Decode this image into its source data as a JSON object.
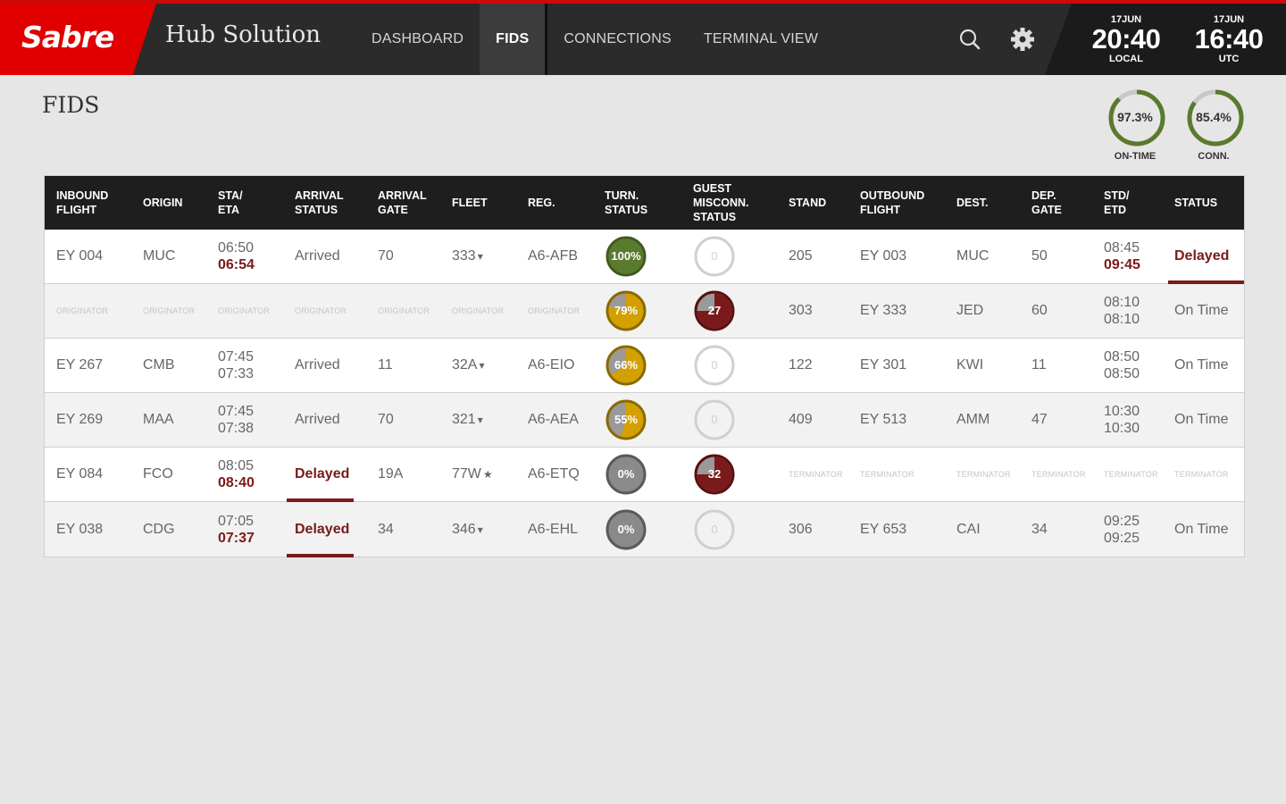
{
  "header": {
    "logo": "Sabre",
    "app_title": "Hub Solution",
    "nav": [
      {
        "label": "DASHBOARD",
        "active": false
      },
      {
        "label": "FIDS",
        "active": true
      },
      {
        "label": "CONNECTIONS",
        "active": false
      },
      {
        "label": "TERMINAL VIEW",
        "active": false
      }
    ],
    "icons": [
      "search-icon",
      "gear-icon"
    ],
    "clocks": [
      {
        "date": "17JUN",
        "time": "20:40",
        "zone": "LOCAL"
      },
      {
        "date": "17JUN",
        "time": "16:40",
        "zone": "UTC"
      }
    ]
  },
  "page_title": "FIDS",
  "kpis": [
    {
      "value": "97.3%",
      "label": "ON-TIME",
      "fraction": 0.88,
      "color": "#5a7a2e"
    },
    {
      "value": "85.4%",
      "label": "CONN.",
      "fraction": 0.85,
      "color": "#5a7a2e"
    }
  ],
  "colors": {
    "brand_red": "#e00000",
    "delay_red": "#7a1a1a",
    "turn_green": "#5a7a2e",
    "turn_amber": "#d4a000",
    "turn_grey": "#8a8a8a"
  },
  "table": {
    "columns": [
      "INBOUND\nFLIGHT",
      "ORIGIN",
      "STA/\nETA",
      "ARRIVAL\nSTATUS",
      "ARRIVAL\nGATE",
      "FLEET",
      "REG.",
      "TURN.\nSTATUS",
      "GUEST\nMISCONN.\nSTATUS",
      "STAND",
      "OUTBOUND\nFLIGHT",
      "DEST.",
      "DEP.\nGATE",
      "STD/\nETD",
      "STATUS"
    ],
    "rows": [
      {
        "inbound": "EY 004",
        "origin": "MUC",
        "sta": "06:50",
        "eta": "06:54",
        "eta_late": true,
        "arr_status": "Arrived",
        "arr_gate": "70",
        "fleet": "333",
        "fleet_mark": "▾",
        "reg": "A6-AFB",
        "turn": "100%",
        "turn_frac": 1.0,
        "turn_color": "#5a7a2e",
        "guest": "0",
        "guest_frac": 0,
        "stand": "205",
        "outbound": "EY 003",
        "dest": "MUC",
        "dep_gate": "50",
        "std": "08:45",
        "etd": "09:45",
        "etd_late": true,
        "status": "Delayed"
      },
      {
        "originator": "ORIGINATOR",
        "turn": "79%",
        "turn_frac": 0.79,
        "turn_color": "#d4a000",
        "guest": "27",
        "guest_frac": 0.75,
        "stand": "303",
        "outbound": "EY 333",
        "dest": "JED",
        "dep_gate": "60",
        "std": "08:10",
        "etd": "08:10",
        "status": "On Time"
      },
      {
        "inbound": "EY 267",
        "origin": "CMB",
        "sta": "07:45",
        "eta": "07:33",
        "arr_status": "Arrived",
        "arr_gate": "11",
        "fleet": "32A",
        "fleet_mark": "▾",
        "reg": "A6-EIO",
        "turn": "66%",
        "turn_frac": 0.66,
        "turn_color": "#d4a000",
        "guest": "0",
        "guest_frac": 0,
        "stand": "122",
        "outbound": "EY 301",
        "dest": "KWI",
        "dep_gate": "11",
        "std": "08:50",
        "etd": "08:50",
        "status": "On Time"
      },
      {
        "inbound": "EY 269",
        "origin": "MAA",
        "sta": "07:45",
        "eta": "07:38",
        "arr_status": "Arrived",
        "arr_gate": "70",
        "fleet": "321",
        "fleet_mark": "▾",
        "reg": "A6-AEA",
        "turn": "55%",
        "turn_frac": 0.55,
        "turn_color": "#d4a000",
        "guest": "0",
        "guest_frac": 0,
        "stand": "409",
        "outbound": "EY 513",
        "dest": "AMM",
        "dep_gate": "47",
        "std": "10:30",
        "etd": "10:30",
        "status": "On Time"
      },
      {
        "inbound": "EY 084",
        "origin": "FCO",
        "sta": "08:05",
        "eta": "08:40",
        "eta_late": true,
        "arr_status": "Delayed",
        "arr_gate": "19A",
        "fleet": "77W",
        "fleet_mark": "★",
        "reg": "A6-ETQ",
        "turn": "0%",
        "turn_frac": 0,
        "turn_color": "#8a8a8a",
        "guest": "32",
        "guest_frac": 0.75,
        "terminator": "TERMINATOR"
      },
      {
        "inbound": "EY 038",
        "origin": "CDG",
        "sta": "07:05",
        "eta": "07:37",
        "eta_late": true,
        "arr_status": "Delayed",
        "arr_gate": "34",
        "fleet": "346",
        "fleet_mark": "▾",
        "reg": "A6-EHL",
        "turn": "0%",
        "turn_frac": 0,
        "turn_color": "#8a8a8a",
        "guest": "0",
        "guest_frac": 0,
        "stand": "306",
        "outbound": "EY 653",
        "dest": "CAI",
        "dep_gate": "34",
        "std": "09:25",
        "etd": "09:25",
        "status": "On Time"
      }
    ]
  }
}
